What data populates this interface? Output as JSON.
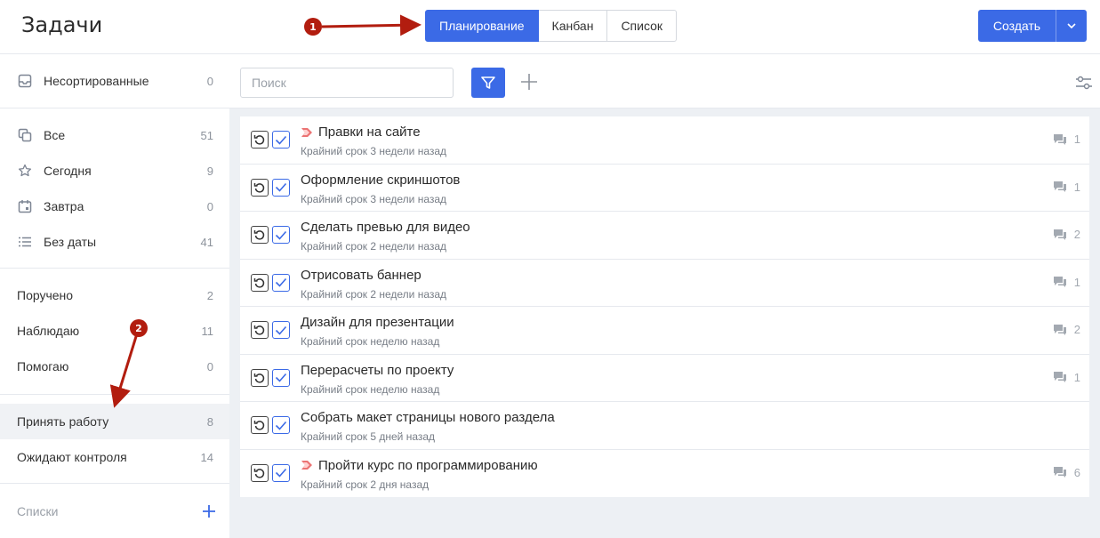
{
  "header": {
    "title": "Задачи",
    "tabs": [
      {
        "label": "Планирование",
        "active": true
      },
      {
        "label": "Канбан",
        "active": false
      },
      {
        "label": "Список",
        "active": false
      }
    ],
    "create_label": "Создать"
  },
  "sidebar": {
    "unsorted": {
      "label": "Несортированные",
      "count": "0"
    },
    "views": [
      {
        "label": "Все",
        "count": "51",
        "icon": "copy-icon"
      },
      {
        "label": "Сегодня",
        "count": "9",
        "icon": "star-icon"
      },
      {
        "label": "Завтра",
        "count": "0",
        "icon": "calendar-icon"
      },
      {
        "label": "Без даты",
        "count": "41",
        "icon": "list-icon"
      }
    ],
    "roles": [
      {
        "label": "Поручено",
        "count": "2"
      },
      {
        "label": "Наблюдаю",
        "count": "11"
      },
      {
        "label": "Помогаю",
        "count": "0"
      }
    ],
    "review": [
      {
        "label": "Принять работу",
        "count": "8"
      },
      {
        "label": "Ожидают контроля",
        "count": "14"
      }
    ],
    "lists_label": "Списки"
  },
  "toolbar": {
    "search_placeholder": "Поиск"
  },
  "tasks": [
    {
      "title": "Правки на сайте",
      "deadline": "Крайний срок 3 недели назад",
      "comments": "1",
      "priority": true
    },
    {
      "title": "Оформление скриншотов",
      "deadline": "Крайний срок 3 недели назад",
      "comments": "1",
      "priority": false
    },
    {
      "title": "Сделать превью для видео",
      "deadline": "Крайний срок 2 недели назад",
      "comments": "2",
      "priority": false
    },
    {
      "title": "Отрисовать баннер",
      "deadline": "Крайний срок 2 недели назад",
      "comments": "1",
      "priority": false
    },
    {
      "title": "Дизайн для презентации",
      "deadline": "Крайний срок неделю назад",
      "comments": "2",
      "priority": false
    },
    {
      "title": "Перерасчеты по проекту",
      "deadline": "Крайний срок неделю назад",
      "comments": "1",
      "priority": false
    },
    {
      "title": "Собрать макет страницы нового раздела",
      "deadline": "Крайний срок 5 дней назад",
      "comments": "",
      "priority": false
    },
    {
      "title": "Пройти курс по программированию",
      "deadline": "Крайний срок 2 дня назад",
      "comments": "6",
      "priority": true
    }
  ],
  "annotations": [
    "1",
    "2"
  ],
  "colors": {
    "accent": "#3b6ae6",
    "annotation": "#b21d0f",
    "priority": "#e85a5a"
  }
}
